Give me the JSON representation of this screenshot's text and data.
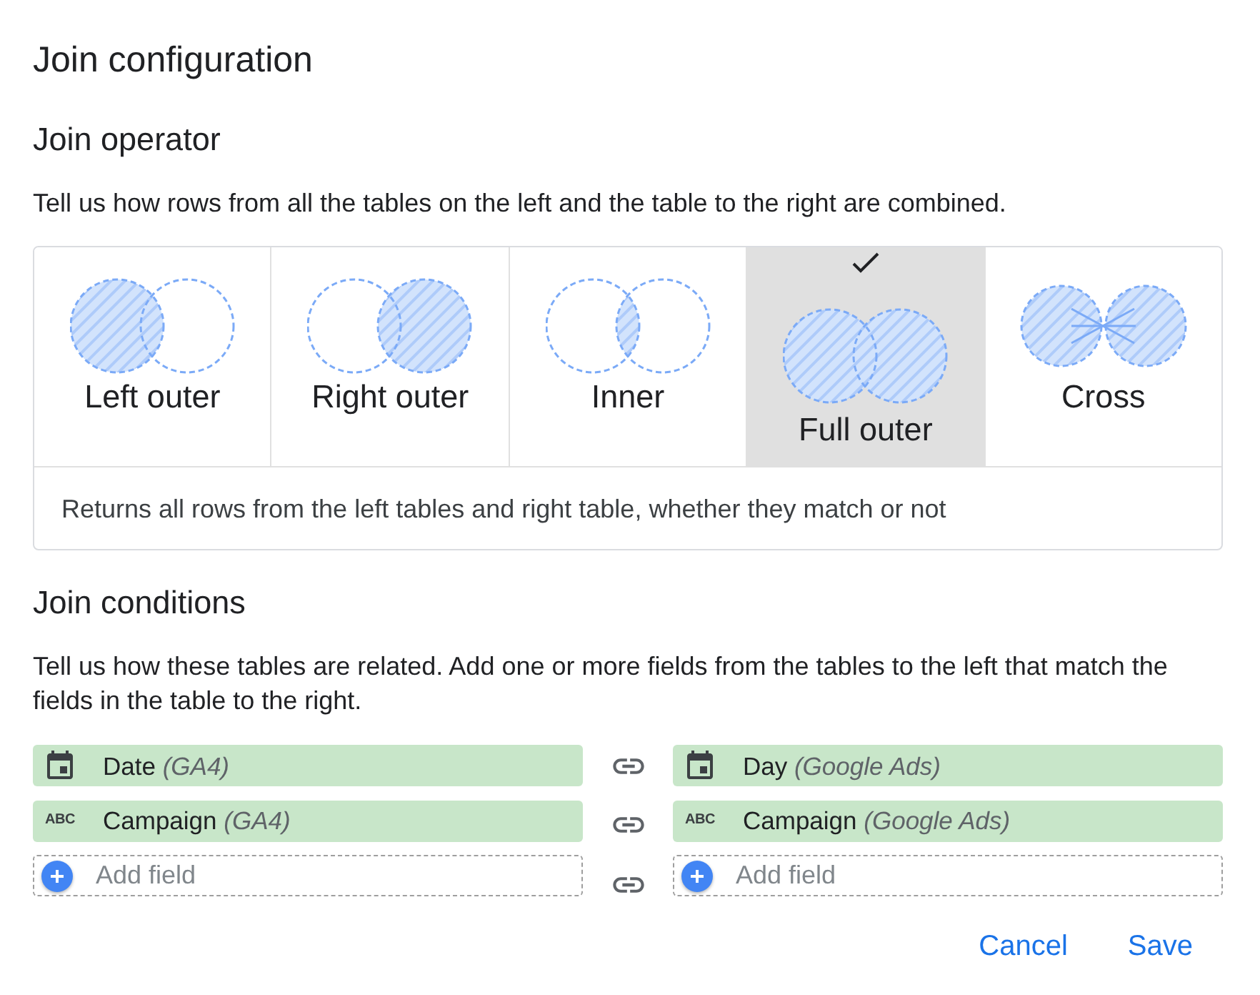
{
  "title": "Join configuration",
  "operator": {
    "heading": "Join operator",
    "description": "Tell us how rows from all the tables on the left and the table to the right are combined.",
    "options": [
      {
        "kind": "left",
        "label": "Left outer",
        "selected": false
      },
      {
        "kind": "right",
        "label": "Right outer",
        "selected": false
      },
      {
        "kind": "inner",
        "label": "Inner",
        "selected": false
      },
      {
        "kind": "full",
        "label": "Full outer",
        "selected": true
      },
      {
        "kind": "cross",
        "label": "Cross",
        "selected": false
      }
    ],
    "selected_description": "Returns all rows from the left tables and right table, whether they match or not"
  },
  "conditions": {
    "heading": "Join conditions",
    "description": "Tell us how these tables are related. Add one or more fields from the tables to the left that match the fields in the table to the right.",
    "left": {
      "fields": [
        {
          "kind": "date",
          "label": "Date *(GA4)*"
        },
        {
          "kind": "text",
          "badge": "ABC",
          "label": "Campaign *(GA4)*"
        }
      ],
      "add_placeholder": "Add field"
    },
    "right": {
      "fields": [
        {
          "kind": "date",
          "label": "Day *(Google Ads)*"
        },
        {
          "kind": "text",
          "badge": "ABC",
          "label": "Campaign *(Google Ads)*"
        }
      ],
      "add_placeholder": "Add field"
    }
  },
  "buttons": [
    "Cancel",
    "Save"
  ]
}
